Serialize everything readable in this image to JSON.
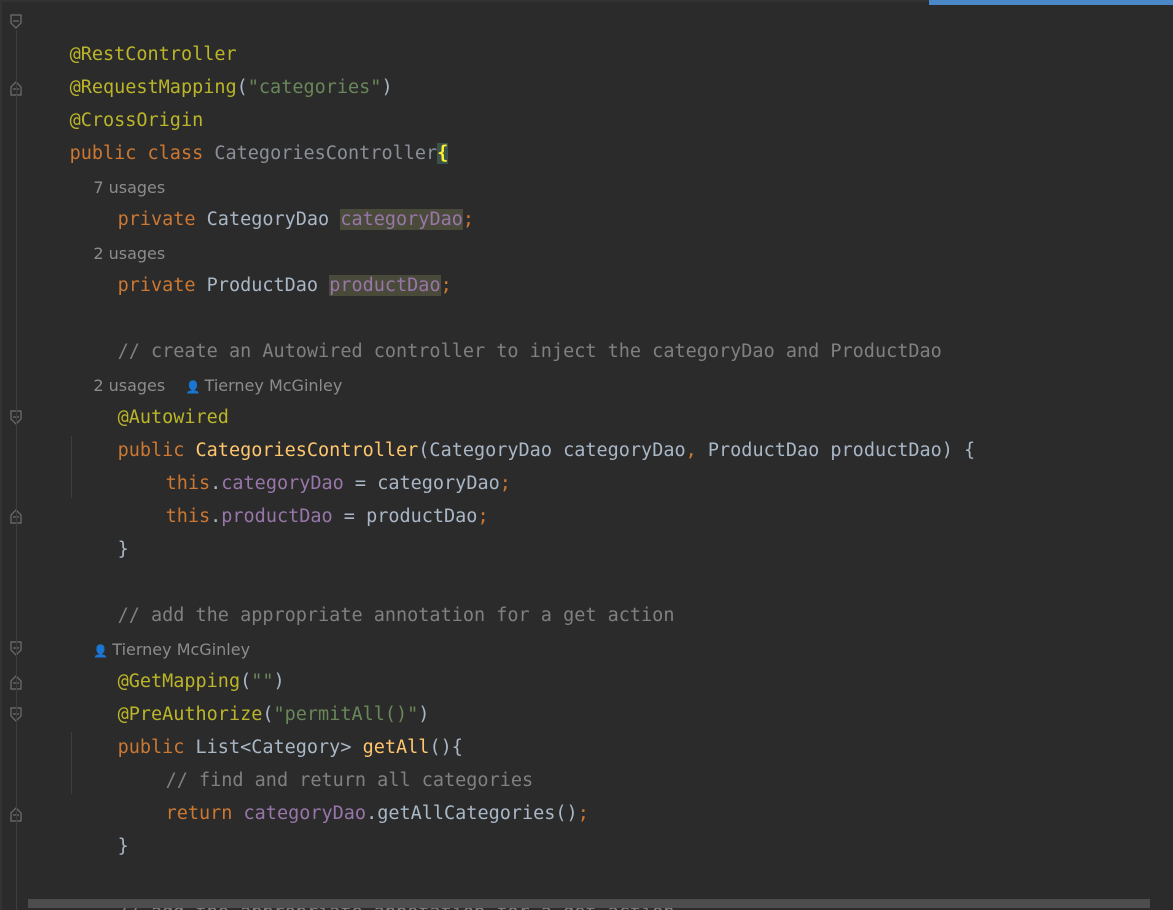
{
  "editor": {
    "lines": {
      "l1": {
        "annotation": "@RestController"
      },
      "l2": {
        "annotation": "@RequestMapping",
        "open": "(",
        "arg": "\"categories\"",
        "close": ")"
      },
      "l3": {
        "annotation": "@CrossOrigin"
      },
      "l4": {
        "kw1": "public",
        "kw2": "class",
        "cls": "CategoriesController",
        "brace": "{"
      },
      "l6": {
        "kw": "private",
        "type": "CategoryDao",
        "field": "categoryDao",
        "semi": ";"
      },
      "l8": {
        "kw": "private",
        "type": "ProductDao",
        "field": "productDao",
        "semi": ";"
      },
      "l10": {
        "comment": "// create an Autowired controller to inject the categoryDao and ProductDao"
      },
      "l12": {
        "annotation": "@Autowired"
      },
      "l13": {
        "kw": "public",
        "name": "CategoriesController",
        "p1": "(CategoryDao categoryDao",
        "comma": ",",
        "p2": " ProductDao productDao) {"
      },
      "l14": {
        "kw": "this",
        "dot": ".",
        "field": "categoryDao",
        "rest": " = categoryDao",
        "semi": ";"
      },
      "l15": {
        "kw": "this",
        "dot": ".",
        "field": "productDao",
        "rest": " = productDao",
        "semi": ";"
      },
      "l16": {
        "text": "}"
      },
      "l18": {
        "comment": "// add the appropriate annotation for a get action"
      },
      "l20": {
        "annotation": "@GetMapping",
        "open": "(",
        "arg": "\"\"",
        "close": ")"
      },
      "l21": {
        "annotation": "@PreAuthorize",
        "open": "(",
        "arg": "\"permitAll()\"",
        "close": ")"
      },
      "l22": {
        "kw": "public",
        "type": "List<Category>",
        "name": "getAll",
        "rest": "(){"
      },
      "l23": {
        "comment": "// find and return all categories"
      },
      "l24": {
        "kw": "return",
        "field": "categoryDao",
        "rest": ".getAllCategories()",
        "semi": ";"
      },
      "l25": {
        "text": "}"
      },
      "l27": {
        "comment": "// add the appropriate annotation for a get action"
      }
    },
    "inlays": {
      "i5": {
        "usages": "7 usages"
      },
      "i7": {
        "usages": "2 usages"
      },
      "i11": {
        "usages": "2 usages",
        "author": "Tierney McGinley"
      },
      "i19": {
        "author": "Tierney McGinley"
      }
    }
  },
  "colors": {
    "background": "#2b2b2b",
    "keyword": "#cc7832",
    "annotation": "#bbb529",
    "string": "#6a8759",
    "comment": "#808080",
    "field": "#9876aa",
    "method": "#ffc66d",
    "accent": "#4a88c7"
  }
}
